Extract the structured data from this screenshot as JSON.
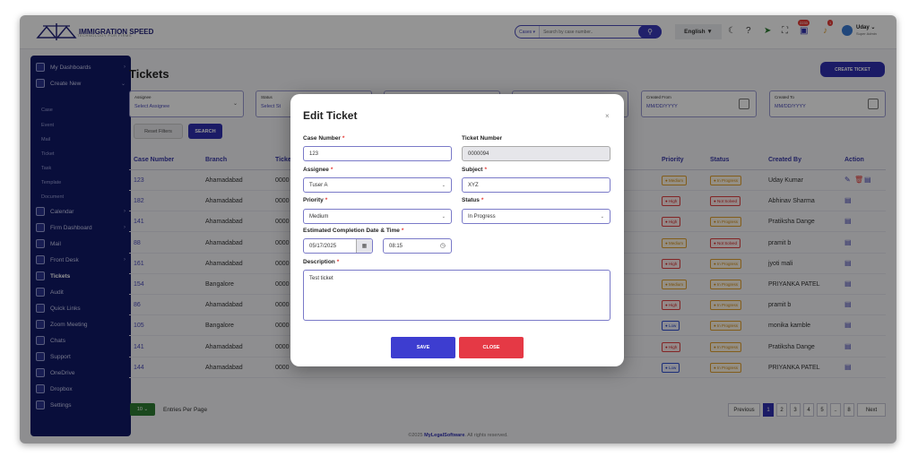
{
  "brand": {
    "name": "IMMIGRATION SPEED",
    "tagline": "TECHNOLOGY FOR FIRMS"
  },
  "topbar": {
    "search_category": "Cases ▾",
    "search_placeholder": "Search by case number..",
    "language": "English ▼",
    "notif_badge_1": "2233",
    "notif_badge_2": "1",
    "user_name": "Uday ⌄",
    "user_role": "Super Admin"
  },
  "sidebar": {
    "items": [
      {
        "label": "My Dashboards"
      },
      {
        "label": "Create New"
      },
      {
        "label": "Calendar"
      },
      {
        "label": "Firm Dashboard"
      },
      {
        "label": "Mail"
      },
      {
        "label": "Front Desk"
      },
      {
        "label": "Tickets"
      },
      {
        "label": "Audit"
      },
      {
        "label": "Quick Links"
      },
      {
        "label": "Zoom Meeting"
      },
      {
        "label": "Chats"
      },
      {
        "label": "Support"
      },
      {
        "label": "OneDrive"
      },
      {
        "label": "Dropbox"
      },
      {
        "label": "Settings"
      }
    ],
    "sub_items": [
      "Case",
      "Event",
      "Mail",
      "Ticket",
      "Task",
      "Template",
      "Document"
    ]
  },
  "page": {
    "title": "Tickets",
    "create_ticket": "CREATE TICKET",
    "filters": {
      "assignee_label": "Assignee",
      "assignee_value": "Select Assignee",
      "status_label": "Status",
      "status_value": "Select St",
      "created_from_label": "Created From",
      "created_from_value": "MM/DD/YYYY",
      "created_to_label": "Created To",
      "created_to_value": "MM/DD/YYYY"
    },
    "reset_filters": "Reset Filters",
    "search": "SEARCH"
  },
  "table": {
    "headers": {
      "case_number": "Case Number",
      "branch": "Branch",
      "ticket": "Ticke",
      "priority": "Priority",
      "status": "Status",
      "created_by": "Created By",
      "action": "Action"
    },
    "rows": [
      {
        "case": "123",
        "branch": "Ahamadabad",
        "ticket": "0000",
        "priority": "● Medium",
        "pclass": "p-medium",
        "status": "● In Progress",
        "sclass": "s-inprog",
        "created_by": "Uday Kumar"
      },
      {
        "case": "182",
        "branch": "Ahamadabad",
        "ticket": "0000",
        "priority": "● High",
        "pclass": "p-high",
        "status": "● Not Solved",
        "sclass": "s-notsolved",
        "created_by": "Abhinav Sharma"
      },
      {
        "case": "141",
        "branch": "Ahamadabad",
        "ticket": "0000",
        "priority": "● High",
        "pclass": "p-high",
        "status": "● In Progress",
        "sclass": "s-inprog",
        "created_by": "Pratiksha Dange"
      },
      {
        "case": "88",
        "branch": "Ahamadabad",
        "ticket": "0000",
        "priority": "● Medium",
        "pclass": "p-medium",
        "status": "● Not Solved",
        "sclass": "s-notsolved",
        "created_by": "pramit b"
      },
      {
        "case": "161",
        "branch": "Ahamadabad",
        "ticket": "0000",
        "priority": "● High",
        "pclass": "p-high",
        "status": "● In Progress",
        "sclass": "s-inprog",
        "created_by": "jyoti mali"
      },
      {
        "case": "154",
        "branch": "Bangalore",
        "ticket": "0000",
        "priority": "● Medium",
        "pclass": "p-medium",
        "status": "● In Progress",
        "sclass": "s-inprog",
        "created_by": "PRIYANKA PATEL"
      },
      {
        "case": "86",
        "branch": "Ahamadabad",
        "ticket": "0000",
        "priority": "● High",
        "pclass": "p-high",
        "status": "● In Progress",
        "sclass": "s-inprog",
        "created_by": "pramit b"
      },
      {
        "case": "105",
        "branch": "Bangalore",
        "ticket": "0000",
        "priority": "● Low",
        "pclass": "p-low",
        "status": "● In Progress",
        "sclass": "s-inprog",
        "created_by": "monika kamble"
      },
      {
        "case": "141",
        "branch": "Ahamadabad",
        "ticket": "0000",
        "priority": "● High",
        "pclass": "p-high",
        "status": "● In Progress",
        "sclass": "s-inprog",
        "created_by": "Pratiksha Dange"
      },
      {
        "case": "144",
        "branch": "Ahamadabad",
        "ticket": "0000",
        "priority": "● Low",
        "pclass": "p-low",
        "status": "● In Progress",
        "sclass": "s-inprog",
        "created_by": "PRIYANKA PATEL"
      }
    ]
  },
  "pagination": {
    "per_page": "10 ⌄",
    "per_page_label": "Entries Per Page",
    "previous": "Previous",
    "pages": [
      "1",
      "2",
      "3",
      "4",
      "5",
      "..",
      "8"
    ],
    "next": "Next"
  },
  "footer": {
    "prefix": "©2025 ",
    "brand": "MyLegalSoftware",
    "suffix": ". All rights reserved."
  },
  "modal": {
    "title": "Edit Ticket",
    "close_x": "×",
    "case_number_label": "Case Number",
    "case_number_value": "123",
    "ticket_number_label": "Ticket Number",
    "ticket_number_value": "0000094",
    "assignee_label": "Assignee",
    "assignee_value": "Tuser A",
    "subject_label": "Subject",
    "subject_value": "XYZ",
    "priority_label": "Priority",
    "priority_value": "Medium",
    "status_label": "Status",
    "status_value": "In Progress",
    "ect_label": "Estimated Completion Date & Time",
    "date_value": "05/17/2025",
    "time_value": "08:15",
    "description_label": "Description",
    "description_value": "Test ticket",
    "save": "SAVE",
    "close": "CLOSE",
    "required_mark": "*"
  },
  "colors": {
    "brand": "#3030b0",
    "sidebar": "#111966",
    "danger": "#e53945"
  }
}
